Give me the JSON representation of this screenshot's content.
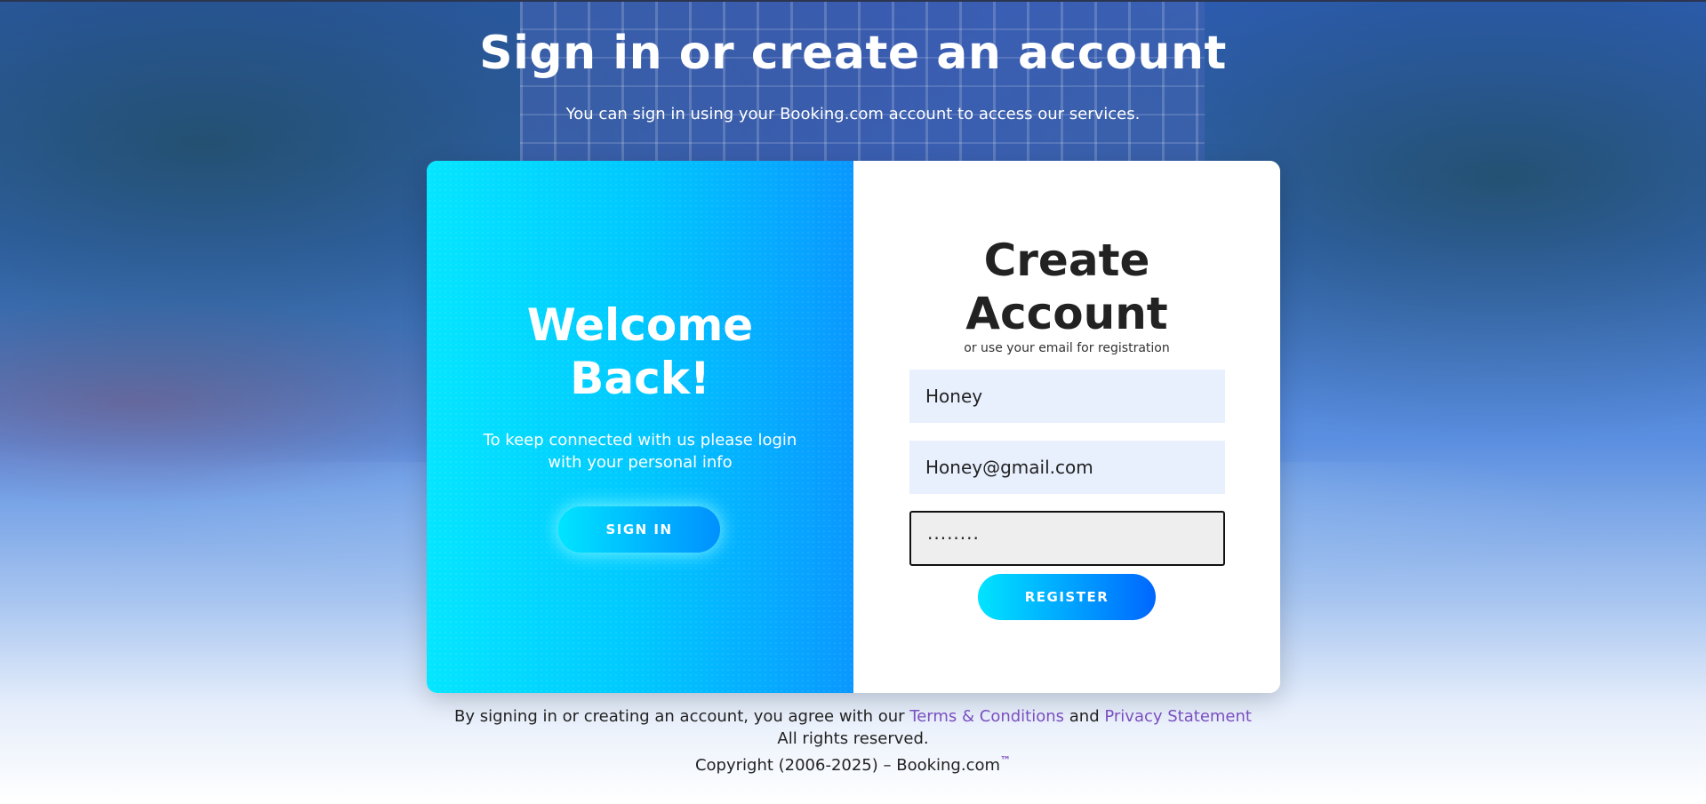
{
  "header": {
    "title": "Sign in or create an account",
    "subtitle": "You can sign in using your Booking.com account to access our services."
  },
  "left_panel": {
    "title_line1": "Welcome",
    "title_line2": "Back!",
    "message_line1": "To keep connected with us please login",
    "message_line2": "with your personal info",
    "signin_label": "SIGN IN"
  },
  "right_panel": {
    "title_line1": "Create",
    "title_line2": "Account",
    "subtitle": "or use your email for registration",
    "name_value": "Honey",
    "email_value": "Honey@gmail.com",
    "password_value": "········",
    "register_label": "REGISTER"
  },
  "footer": {
    "agree_prefix": "By signing in or creating an account, you agree with our ",
    "terms_label": "Terms & Conditions",
    "and_text": " and ",
    "privacy_label": "Privacy Statement",
    "rights": "All rights reserved.",
    "copyright": "Copyright (2006-2025) – Booking.com",
    "trademark": "™"
  },
  "colors": {
    "accent_cyan": "#00e4ff",
    "accent_blue": "#0090ff",
    "link_purple": "#7a4fc0"
  }
}
